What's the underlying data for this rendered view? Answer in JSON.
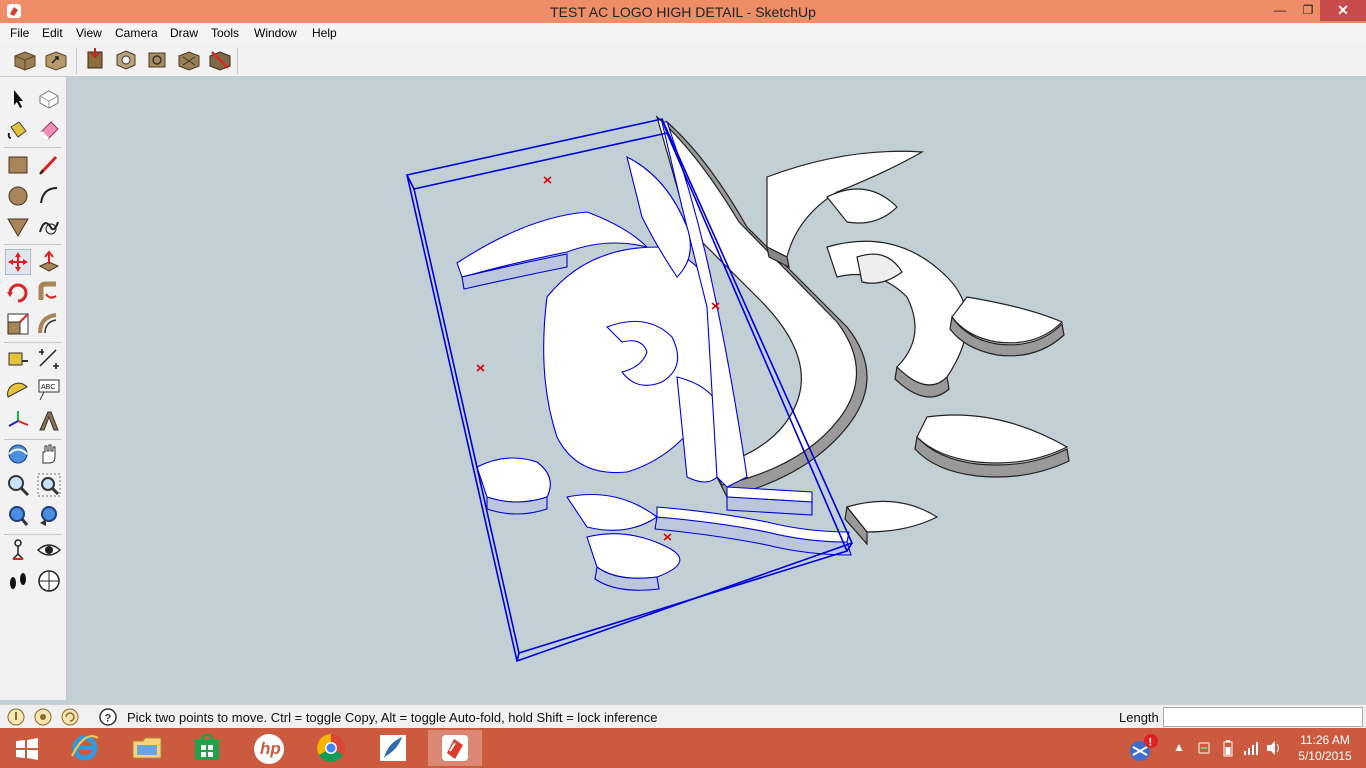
{
  "window": {
    "title": "TEST AC LOGO HIGH DETAIL - SketchUp",
    "min_glyph": "—",
    "max_glyph": "❐",
    "close_glyph": "✕"
  },
  "menu": [
    "File",
    "Edit",
    "View",
    "Camera",
    "Draw",
    "Tools",
    "Window",
    "Help"
  ],
  "top_toolbar_icons": [
    "get-models-icon",
    "share-model-icon",
    "share-component-icon",
    "photo-textures-icon",
    "dynamic-components-icon",
    "add-location-icon",
    "toggle-terrain-icon"
  ],
  "left_toolbar_icons": [
    "select-icon",
    "make-component-icon",
    "paint-bucket-icon",
    "eraser-icon",
    "rectangle-icon",
    "line-icon",
    "circle-icon",
    "arc-icon",
    "polygon-icon",
    "freehand-icon",
    "move-icon",
    "push-pull-icon",
    "rotate-icon",
    "follow-me-icon",
    "scale-icon",
    "offset-icon",
    "tape-measure-icon",
    "dimension-icon",
    "protractor-icon",
    "text-icon",
    "axes-icon",
    "3d-text-icon",
    "orbit-icon",
    "pan-icon",
    "zoom-icon",
    "zoom-window-icon",
    "zoom-extents-icon",
    "previous-view-icon",
    "position-camera-icon",
    "look-around-icon",
    "walk-icon",
    "section-plane-icon"
  ],
  "status": {
    "message": "Pick two points to move.  Ctrl = toggle Copy, Alt = toggle Auto-fold, hold Shift = lock inference",
    "vcb_label": "Length",
    "vcb_value": ""
  },
  "taskbar": {
    "apps": [
      "start-icon",
      "internet-explorer-icon",
      "file-explorer-icon",
      "store-icon",
      "hp-icon",
      "chrome-icon",
      "feather-app-icon",
      "sketchup-icon"
    ],
    "hp_label": "hp",
    "time": "11:26 AM",
    "date": "5/10/2015",
    "tray_arrow": "▲"
  },
  "colors": {
    "titlebar": "#ee8d66",
    "taskbar": "#cc5a3f",
    "viewport": "#c2cfd4",
    "selection": "#0000dd",
    "inference": "#dd0000"
  }
}
